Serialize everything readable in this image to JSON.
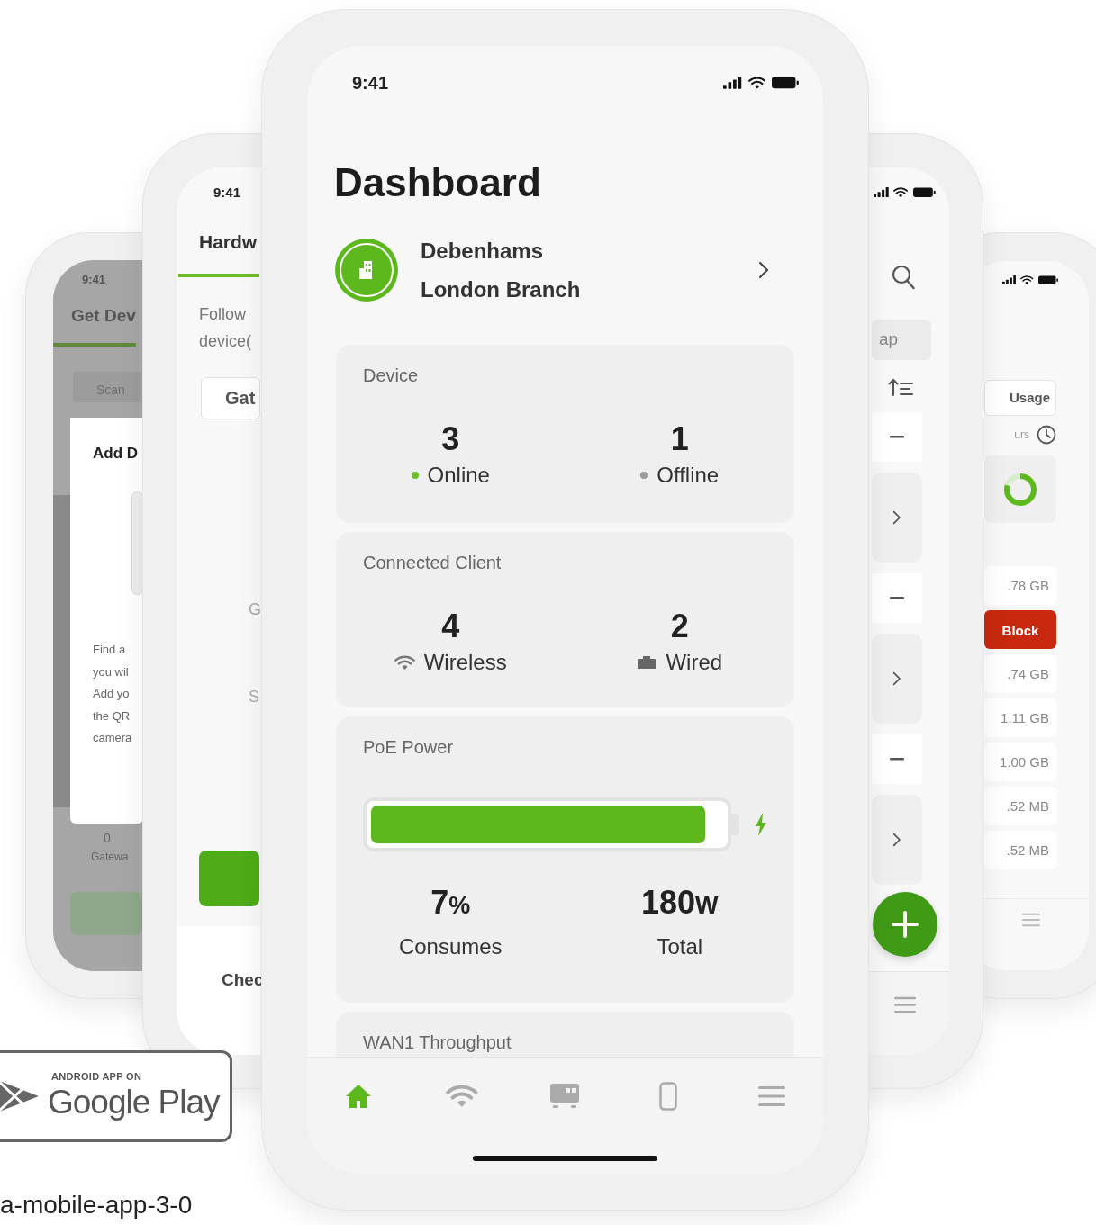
{
  "back_left_phone": {
    "time": "9:41",
    "title": "Get Dev",
    "tab": "Scan",
    "dialog": {
      "title": "Add D",
      "lines": [
        "Find a",
        "you wil",
        "Add yo",
        "the QR",
        "camera"
      ]
    },
    "stat": {
      "value": "0",
      "label": "Gatewa"
    }
  },
  "left_phone": {
    "time": "9:41",
    "title": "Hardw",
    "intro_lines": [
      "Follow",
      "device("
    ],
    "tab": "Gat",
    "fragments": [
      "G",
      "S"
    ],
    "footer": "Chec"
  },
  "main_phone": {
    "time": "9:41",
    "title": "Dashboard",
    "site": {
      "name": "Debenhams",
      "branch": "London Branch"
    },
    "cards": [
      {
        "kind": "device",
        "title": "Device",
        "stats": [
          {
            "value": "3",
            "label": "Online",
            "kind": "dot",
            "color": "#6cbd2a"
          },
          {
            "value": "1",
            "label": "Offline",
            "kind": "dot",
            "color": "#9a9a9a"
          }
        ]
      },
      {
        "kind": "clients",
        "title": "Connected Client",
        "stats": [
          {
            "value": "4",
            "label": "Wireless",
            "kind": "wifi"
          },
          {
            "value": "2",
            "label": "Wired",
            "kind": "wired"
          }
        ]
      },
      {
        "kind": "power",
        "title": "PoE Power",
        "level": 0.95,
        "stats": [
          {
            "value": "7",
            "unit": "%",
            "label": "Consumes"
          },
          {
            "value": "180",
            "unit": "W",
            "label": "Total"
          }
        ]
      },
      {
        "kind": "partial",
        "title": "WAN1 Throughput"
      }
    ],
    "nav": [
      {
        "kind": "home",
        "selected": true
      },
      {
        "kind": "wifi",
        "selected": false
      },
      {
        "kind": "gateway",
        "selected": false
      },
      {
        "kind": "phone",
        "selected": false
      },
      {
        "kind": "menu",
        "selected": false
      }
    ]
  },
  "right_phone": {
    "tab": "ap",
    "rows": [
      {
        "kind": "collapse"
      },
      {
        "kind": "card"
      },
      {
        "kind": "collapse"
      },
      {
        "kind": "card"
      },
      {
        "kind": "collapse"
      },
      {
        "kind": "card"
      }
    ]
  },
  "back_right_phone": {
    "button": "Usage",
    "period": "urs",
    "rows": [
      {
        "kind": "value",
        "text": ".78 GB"
      },
      {
        "kind": "action",
        "text": "Block"
      },
      {
        "kind": "value",
        "text": ".74 GB"
      },
      {
        "kind": "value",
        "text": "1.11 GB"
      },
      {
        "kind": "value",
        "text": "1.00 GB"
      },
      {
        "kind": "value",
        "text": ".52 MB"
      },
      {
        "kind": "value",
        "text": ".52 MB"
      }
    ]
  },
  "store_badge": {
    "overline": "ANDROID APP ON",
    "name": "Google Play"
  },
  "caption": "a-mobile-app-3-0"
}
